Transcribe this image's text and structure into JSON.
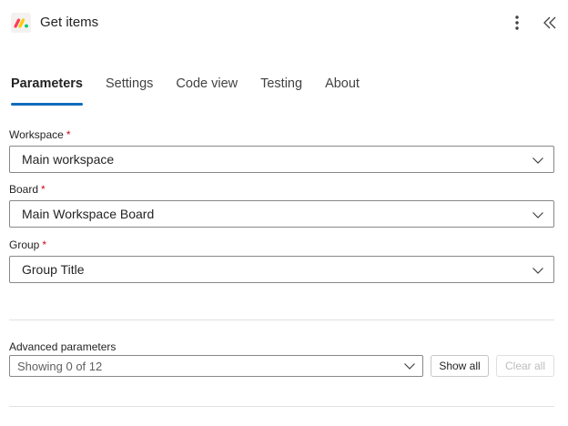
{
  "header": {
    "title": "Get items",
    "logo_icon": "monday-logo-icon",
    "more_icon": "more-vertical-icon",
    "collapse_icon": "double-chevron-left-icon"
  },
  "tabs": [
    {
      "label": "Parameters",
      "active": true
    },
    {
      "label": "Settings",
      "active": false
    },
    {
      "label": "Code view",
      "active": false
    },
    {
      "label": "Testing",
      "active": false
    },
    {
      "label": "About",
      "active": false
    }
  ],
  "fields": {
    "workspace": {
      "label": "Workspace",
      "required_mark": "*",
      "value": "Main workspace"
    },
    "board": {
      "label": "Board",
      "required_mark": "*",
      "value": "Main Workspace Board"
    },
    "group": {
      "label": "Group",
      "required_mark": "*",
      "value": "Group Title"
    }
  },
  "advanced": {
    "label": "Advanced parameters",
    "value": "Showing 0 of 12",
    "show_all_label": "Show all",
    "clear_all_label": "Clear all"
  },
  "colors": {
    "accent": "#0f6cbd",
    "required": "#c50f1f",
    "logo_red": "#ff3d57",
    "logo_yellow": "#ffcb00",
    "logo_green": "#00ca72"
  }
}
